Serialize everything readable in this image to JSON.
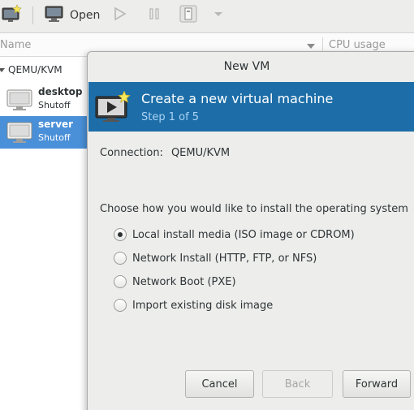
{
  "toolbar": {
    "open_label": "Open"
  },
  "list_header": {
    "name_col": "Name",
    "cpu_col": "CPU usage"
  },
  "tree": {
    "group_label": "QEMU/KVM",
    "vms": [
      {
        "name": "desktop",
        "state": "Shutoff",
        "selected": false
      },
      {
        "name": "server",
        "state": "Shutoff",
        "selected": true
      }
    ]
  },
  "dialog": {
    "title": "New VM",
    "banner_title": "Create a new virtual machine",
    "banner_step": "Step 1 of 5",
    "connection_label": "Connection:",
    "connection_value": "QEMU/KVM",
    "prompt": "Choose how you would like to install the operating system",
    "options": [
      {
        "label": "Local install media (ISO image or CDROM)",
        "checked": true
      },
      {
        "label": "Network Install (HTTP, FTP, or NFS)",
        "checked": false
      },
      {
        "label": "Network Boot (PXE)",
        "checked": false
      },
      {
        "label": "Import existing disk image",
        "checked": false
      }
    ],
    "buttons": {
      "cancel": "Cancel",
      "back": "Back",
      "forward": "Forward"
    }
  },
  "colors": {
    "banner": "#1d6ea8",
    "selection": "#4a90d9",
    "step_text": "#a9d3f5"
  },
  "icons": [
    "new-vm-icon",
    "open-console-icon",
    "run-icon",
    "pause-icon",
    "shutdown-icon",
    "dropdown-arrow-icon",
    "vm-monitor-icon",
    "sort-arrow-icon",
    "expander-icon"
  ]
}
